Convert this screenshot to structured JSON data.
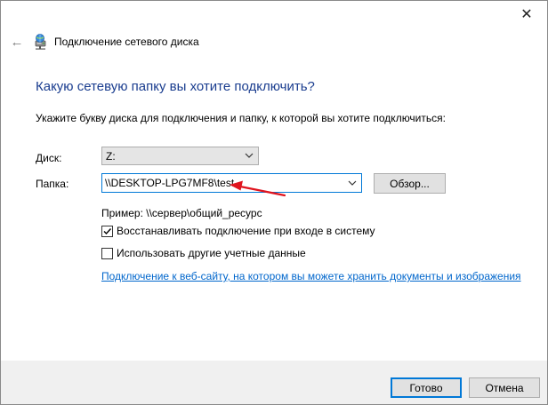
{
  "window": {
    "title": "Подключение сетевого диска",
    "close_glyph": "✕",
    "back_glyph": "←"
  },
  "main": {
    "heading": "Какую сетевую папку вы хотите подключить?",
    "instruction": "Укажите букву диска для подключения и папку, к которой вы хотите подключиться:",
    "drive_label": "Диск:",
    "drive_value": "Z:",
    "folder_label": "Папка:",
    "folder_value": "\\\\DESKTOP-LPG7MF8\\test",
    "browse_label": "Обзор...",
    "example": "Пример: \\\\сервер\\общий_ресурс",
    "reconnect_label": "Восстанавливать подключение при входе в систему",
    "reconnect_checked": true,
    "other_creds_label": "Использовать другие учетные данные",
    "other_creds_checked": false,
    "link_text": "Подключение к веб-сайту, на котором вы можете хранить документы и изображения"
  },
  "footer": {
    "ok_label": "Готово",
    "cancel_label": "Отмена"
  },
  "colors": {
    "heading": "#1a3d8f",
    "link": "#0066cc",
    "focus": "#0078d7",
    "annotation": "#e0141e"
  },
  "icons": {
    "title": "network-drive-icon",
    "close": "close-icon",
    "back": "back-arrow-icon",
    "dropdown": "chevron-down-icon",
    "check": "checkmark-icon",
    "annotation": "red-arrow-icon"
  }
}
